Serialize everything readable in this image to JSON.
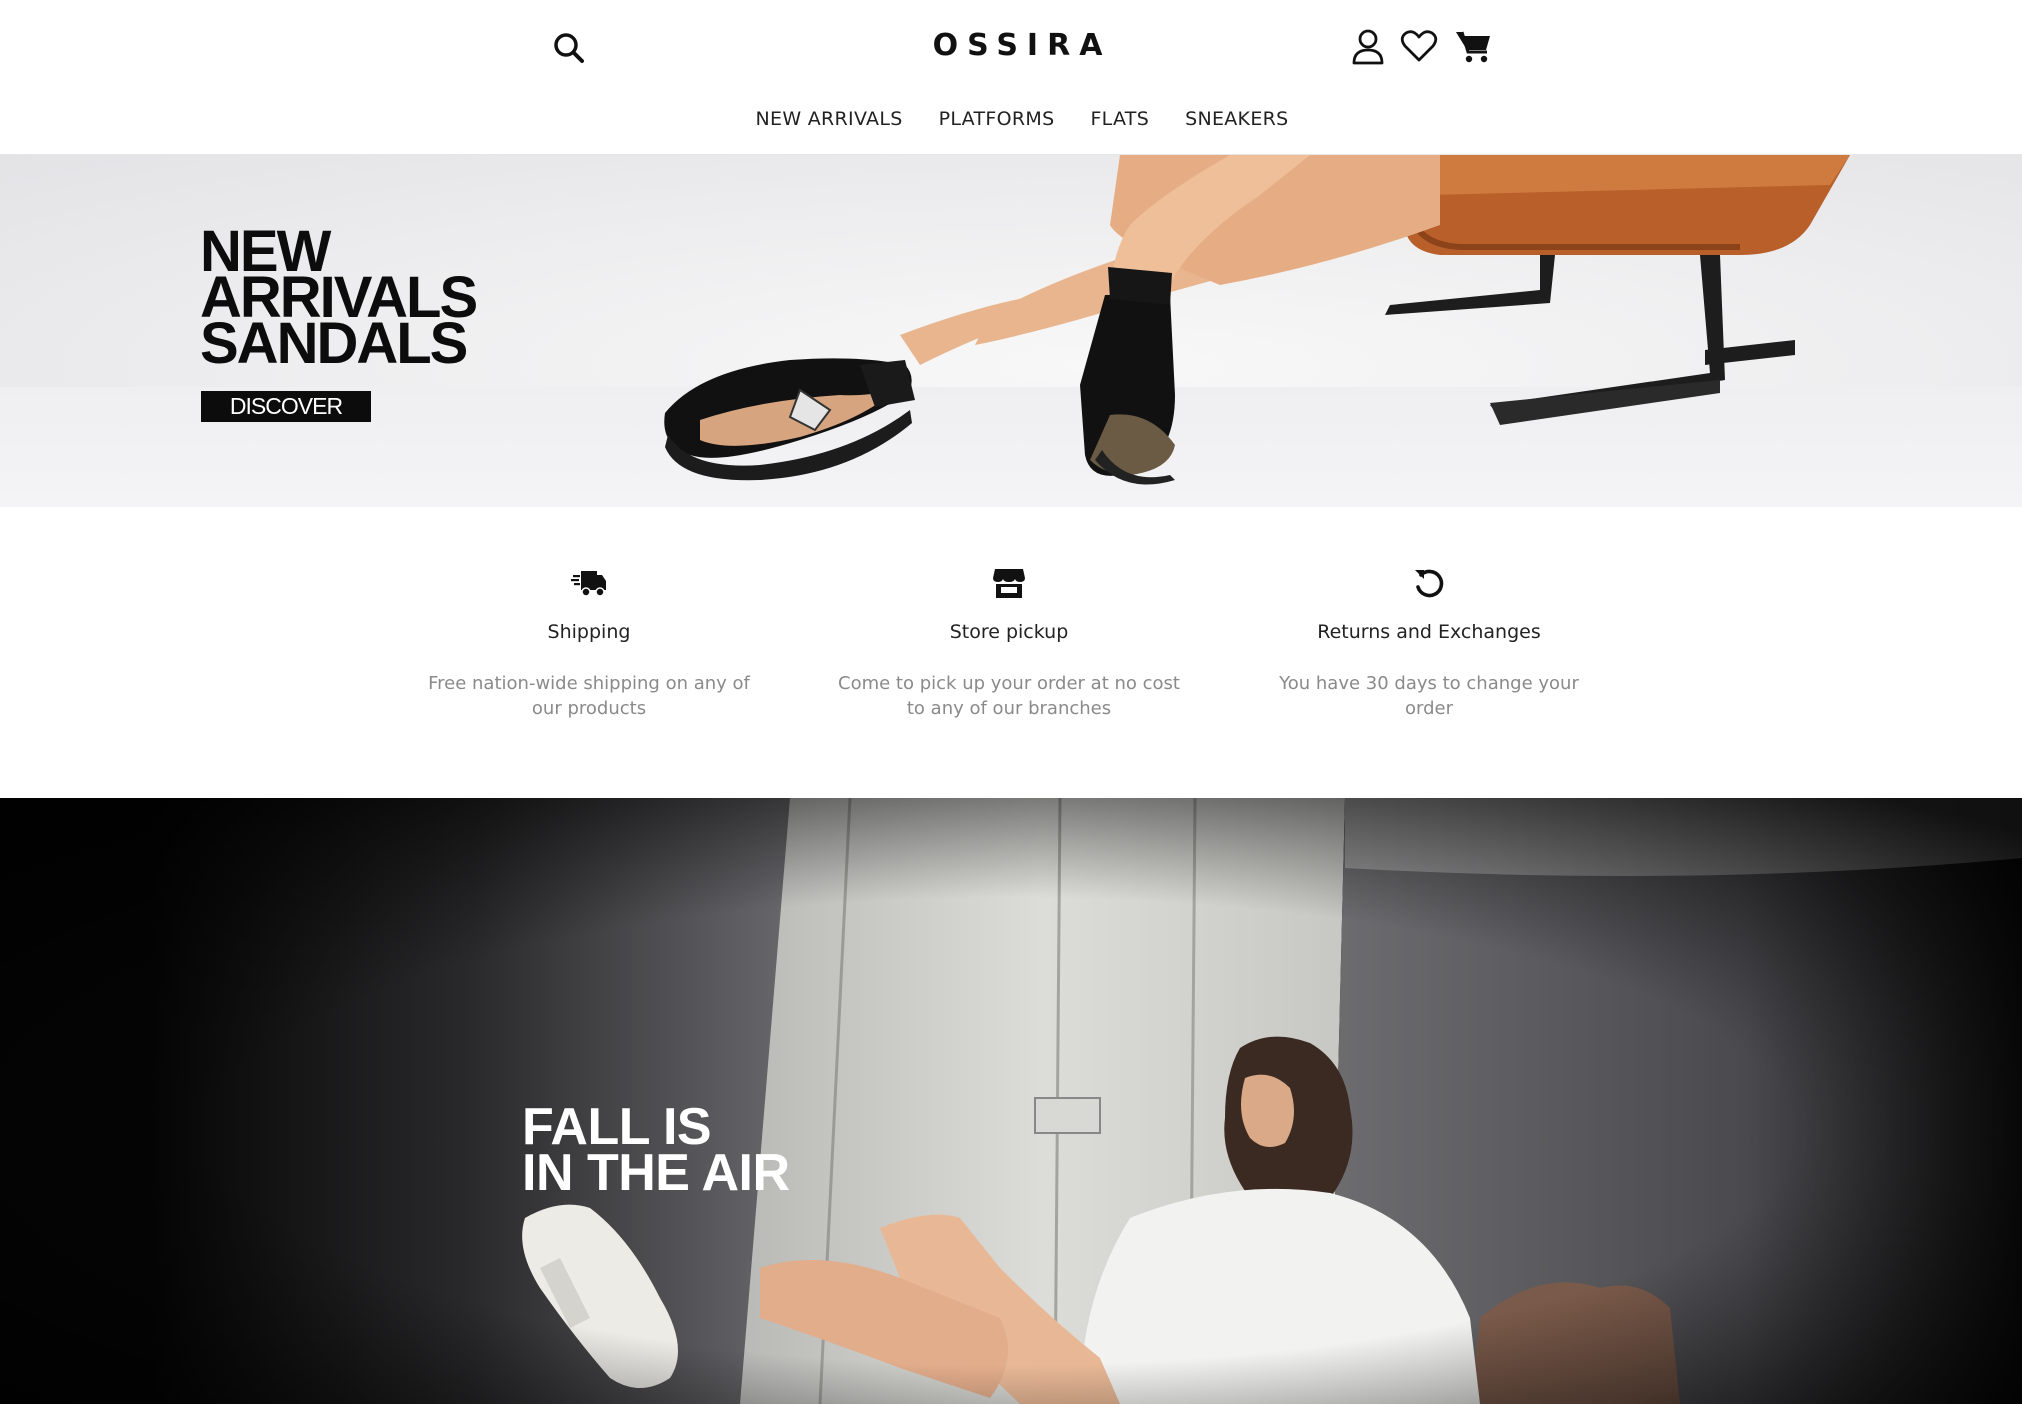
{
  "brand": {
    "name": "OSSIRA"
  },
  "header": {
    "icons": [
      "search-icon",
      "user-icon",
      "heart-icon",
      "cart-icon"
    ]
  },
  "nav": {
    "items": [
      "NEW ARRIVALS",
      "PLATFORMS",
      "FLATS",
      "SNEAKERS"
    ]
  },
  "hero1": {
    "title_lines": [
      "NEW",
      "ARRIVALS",
      "SANDALS"
    ],
    "button": "DISCOVER"
  },
  "features": [
    {
      "icon": "truck-icon",
      "title": "Shipping",
      "desc_lines": [
        "Free nation-wide shipping on any of",
        "our products"
      ]
    },
    {
      "icon": "store-icon",
      "title": "Store pickup",
      "desc_lines": [
        "Come to pick up your order at no cost",
        "to any of our branches"
      ]
    },
    {
      "icon": "undo-icon",
      "title": "Returns and Exchanges",
      "desc_lines": [
        "You have 30 days to change your",
        "order"
      ]
    }
  ],
  "hero2": {
    "title_lines": [
      "FALL IS",
      "IN THE AIR"
    ]
  },
  "colors": {
    "primary": "#111111",
    "muted": "#8a8a8a",
    "hero_bg": "#ececee"
  }
}
